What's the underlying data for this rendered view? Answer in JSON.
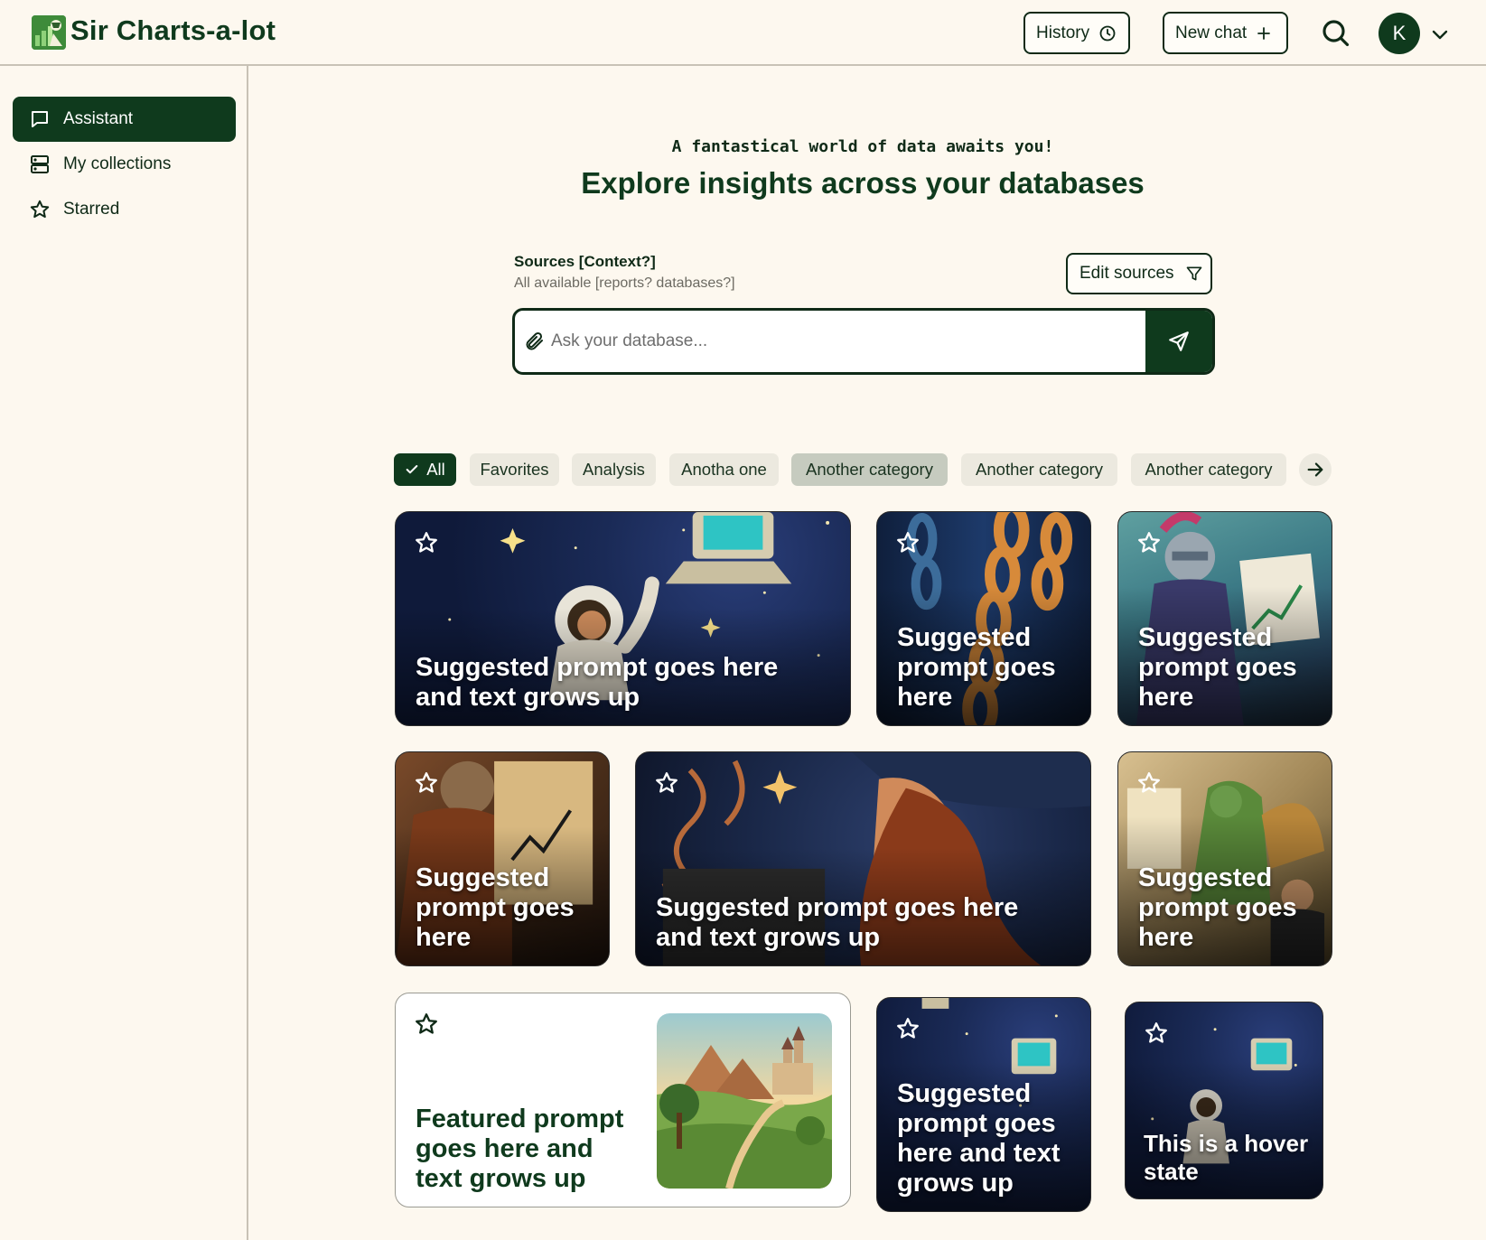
{
  "app": {
    "title": "Sir Charts-a-lot",
    "accent_color": "#0f3a1d",
    "background_color": "#fdf8ef"
  },
  "header": {
    "history_label": "History",
    "new_chat_label": "New chat",
    "avatar_initial": "K",
    "icons": [
      "clock-icon",
      "plus-icon",
      "search-icon",
      "chevron-down-icon"
    ]
  },
  "sidebar": {
    "items": [
      {
        "label": "Assistant",
        "icon": "chat-bubble-icon",
        "active": true
      },
      {
        "label": "My collections",
        "icon": "stack-icon",
        "active": false
      },
      {
        "label": "Starred",
        "icon": "star-icon",
        "active": false
      }
    ]
  },
  "main": {
    "tagline": "A fantastical world of data awaits you!",
    "headline": "Explore insights across your databases",
    "sources": {
      "title": "Sources [Context?]",
      "subtitle": "All available [reports? databases?]",
      "edit_label": "Edit sources"
    },
    "ask": {
      "placeholder": "Ask your database..."
    },
    "chips": [
      {
        "label": "All",
        "selected": true
      },
      {
        "label": "Favorites"
      },
      {
        "label": "Analysis"
      },
      {
        "label": "Anotha one"
      },
      {
        "label": "Another category",
        "highlighted": true
      },
      {
        "label": "Another category"
      },
      {
        "label": "Another category"
      }
    ],
    "cards": [
      {
        "text": "Suggested prompt goes here and text grows up",
        "theme": "astronaut-space"
      },
      {
        "text": "Suggested prompt goes here",
        "theme": "chains"
      },
      {
        "text": "Suggested prompt goes here",
        "theme": "knight-chart"
      },
      {
        "text": "Suggested prompt goes here",
        "theme": "knight-scroll"
      },
      {
        "text": "Suggested prompt goes here and text grows up",
        "theme": "witch"
      },
      {
        "text": "Suggested prompt goes here",
        "theme": "dragon-office"
      },
      {
        "text": "Featured prompt goes here and text grows up",
        "theme": "castle-landscape"
      },
      {
        "text": "Suggested prompt goes here and text grows up",
        "theme": "astronaut-space"
      },
      {
        "text": "This is a hover state",
        "theme": "astronaut-space"
      }
    ]
  }
}
